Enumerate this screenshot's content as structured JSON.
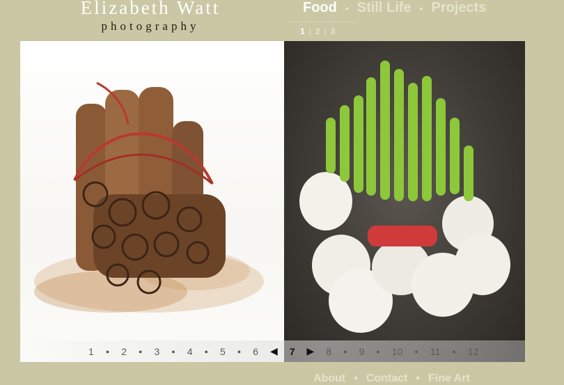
{
  "brand": {
    "name": "Elizabeth Watt",
    "tagline": "photography"
  },
  "nav": {
    "items": [
      "Food",
      "Still Life",
      "Projects"
    ],
    "active": "Food",
    "separator": "•"
  },
  "subnav": {
    "pages": [
      "1",
      "2",
      "3"
    ],
    "active": "1",
    "separator": "|"
  },
  "gallery": {
    "left_image_icon": "cinnamon-sticks-photo",
    "right_image_icon": "spring-onions-photo",
    "pages": [
      "1",
      "2",
      "3",
      "4",
      "5",
      "6",
      "7",
      "8",
      "9",
      "10",
      "11",
      "12"
    ],
    "current": "7",
    "prev_icon": "prev-arrow-icon",
    "next_icon": "next-arrow-icon"
  },
  "footer": {
    "items": [
      "About",
      "Contact",
      "Fine Art"
    ],
    "separator": "•"
  },
  "colors": {
    "background": "#cbc7a4",
    "nav_text": "#e6e3cc",
    "active": "#ffffff"
  }
}
